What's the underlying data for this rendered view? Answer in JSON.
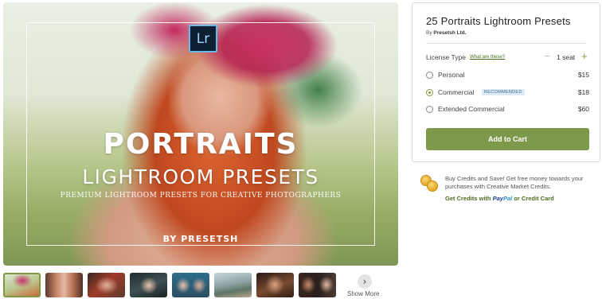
{
  "hero": {
    "badge": "Lr",
    "title_line1": "PORTRAITS",
    "title_line2": "LIGHTROOM PRESETS",
    "tagline": "PREMIUM LIGHTROOM PRESETS FOR CREATIVE PHOTOGRAPHERS",
    "credit": "BY PRESETSH"
  },
  "gallery": {
    "thumbnail_count": 9,
    "selected_index": 0,
    "show_more_icon": "chevron-right-icon",
    "show_more_label": "Show More"
  },
  "product": {
    "title": "25 Portraits Lightroom Presets",
    "by_prefix": "By",
    "author": "Presetsh Ltd.",
    "license_label": "License Type",
    "license_help_link": "What are these?",
    "seat_decrement": "−",
    "seat_value": "1 seat",
    "seat_increment": "+",
    "licenses": [
      {
        "name": "Personal",
        "price": "$15",
        "selected": false,
        "badge": ""
      },
      {
        "name": "Commercial",
        "price": "$18",
        "selected": true,
        "badge": "RECOMMENDED"
      },
      {
        "name": "Extended Commercial",
        "price": "$60",
        "selected": false,
        "badge": ""
      }
    ],
    "add_to_cart": "Add to Cart"
  },
  "credits": {
    "icon": "coins-icon",
    "promo_text": "Buy Credits and Save! Get free money towards your purchases with Creative Market Credits.",
    "link_prefix": "Get Credits with",
    "paypal_pay": "Pay",
    "paypal_pal": "Pal",
    "link_suffix": "or Credit Card"
  },
  "colors": {
    "accent_green": "#7d9a4b",
    "link_green": "#4a6d1f",
    "badge_blue": "#dcebf5",
    "paypal_dark": "#1b3f8f",
    "paypal_light": "#2a90d6"
  }
}
